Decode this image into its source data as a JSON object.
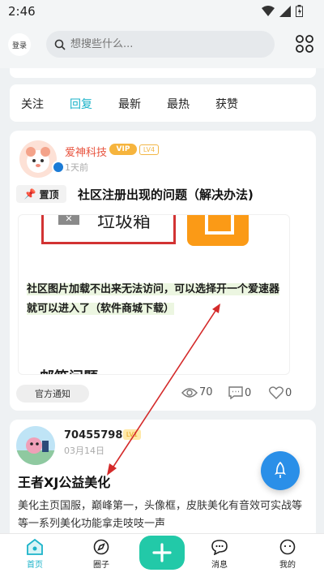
{
  "status_bar": {
    "time": "2:46"
  },
  "header": {
    "login_label": "登录",
    "search_placeholder": "想搜些什么..."
  },
  "tabs": [
    {
      "label": "关注",
      "active": false
    },
    {
      "label": "回复",
      "active": true
    },
    {
      "label": "最新",
      "active": false
    },
    {
      "label": "最热",
      "active": false
    },
    {
      "label": "获赞",
      "active": false
    }
  ],
  "post1": {
    "author": "爱神科技",
    "vip_badge": "VIP",
    "level_badge": "LV4",
    "time": "1天前",
    "pin_label": "置顶",
    "title": "社区注册出现的问题（解决办法)",
    "preview_box_label": "垃圾箱",
    "preview_note": "社区图片加载不出来无法访问，可以选择开一个爱速器就可以进入了（软件商城下载）",
    "preview_cut_text": "邮箱问题",
    "tag": "官方通知",
    "views": "70",
    "comments": "0",
    "likes": "0"
  },
  "post2": {
    "author": "704557988",
    "level_badge": "LV1",
    "date": "03月14日",
    "title": "王者XJ公益美化",
    "body": "美化主页国服，巅峰第一，头像框，皮肤美化有音效可实战等等一系列美化功能拿走吱吱一声"
  },
  "nav": {
    "home": "首页",
    "circle": "圈子",
    "messages": "消息",
    "mine": "我的"
  },
  "colors": {
    "accent": "#1bb3c9",
    "add_button": "#22c9a8",
    "fab": "#2a8fe8",
    "author_red": "#e8533e",
    "arrow": "#d42a2a"
  }
}
